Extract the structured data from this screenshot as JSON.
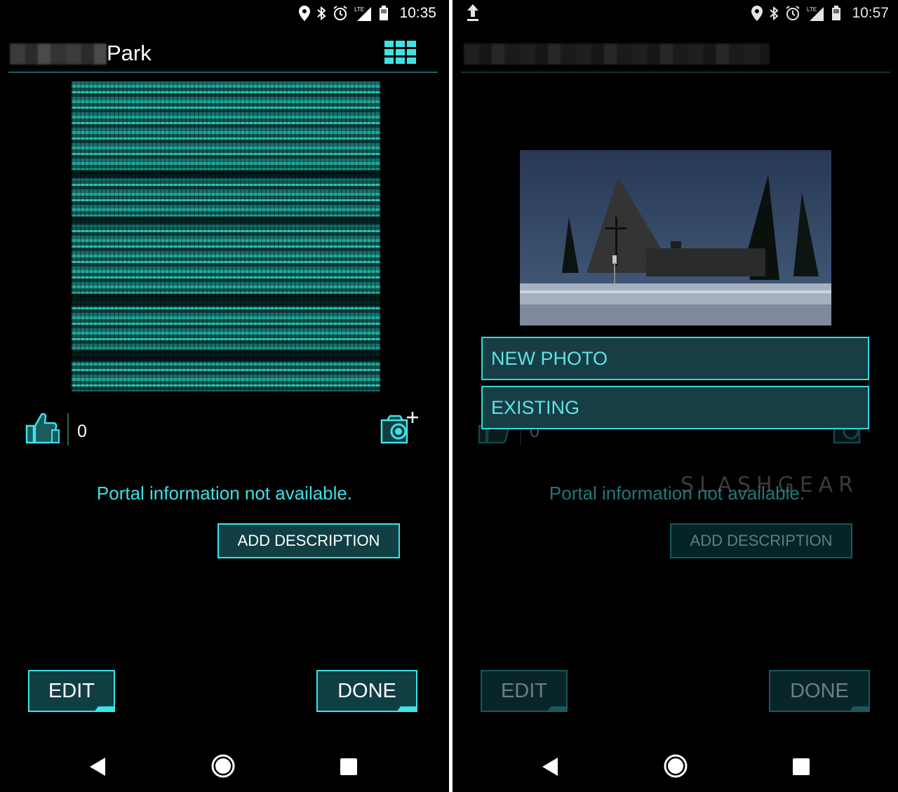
{
  "left": {
    "status": {
      "time": "10:35",
      "network": "LTE"
    },
    "header": {
      "title_suffix": "Park"
    },
    "likes": {
      "count": "0"
    },
    "portal_info": "Portal information not available.",
    "add_description": "ADD DESCRIPTION",
    "buttons": {
      "edit": "EDIT",
      "done": "DONE"
    }
  },
  "right": {
    "status": {
      "time": "10:57",
      "network": "LTE"
    },
    "likes": {
      "count": "0"
    },
    "portal_info": "Portal information not available.",
    "add_description": "ADD DESCRIPTION",
    "photo_menu": {
      "new_photo": "NEW PHOTO",
      "existing": "EXISTING"
    },
    "buttons": {
      "edit": "EDIT",
      "done": "DONE"
    },
    "watermark": "SLASHGEAR"
  },
  "colors": {
    "accent": "#3de3e6",
    "button_bg": "#0f3e43",
    "text_cyan": "#3ee0e3"
  },
  "icons": [
    "location-icon",
    "bluetooth-icon",
    "alarm-icon",
    "signal-icon",
    "battery-icon",
    "grid-icon",
    "thumbs-up-icon",
    "camera-add-icon",
    "upload-icon",
    "nav-back-icon",
    "nav-home-icon",
    "nav-recent-icon"
  ]
}
